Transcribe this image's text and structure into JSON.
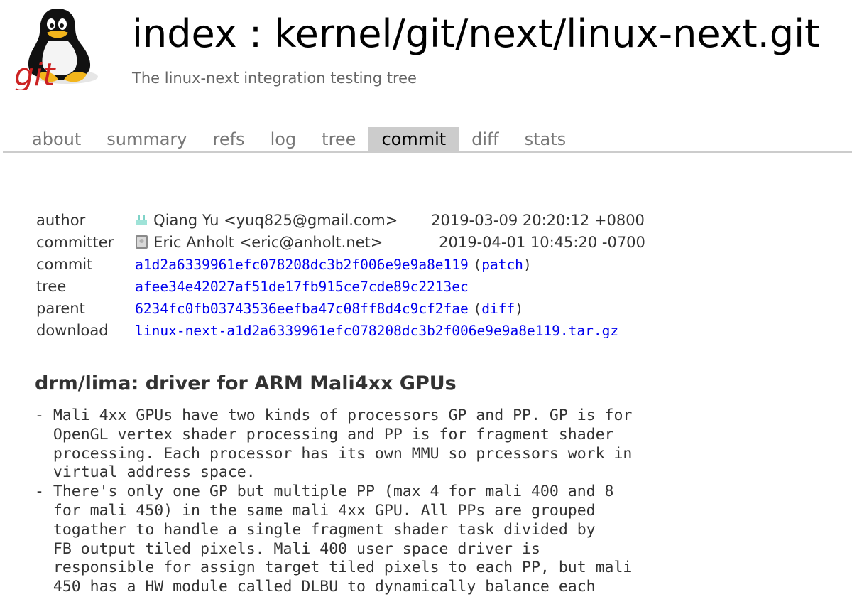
{
  "logo": {
    "text": "git"
  },
  "header": {
    "title": "index : kernel/git/next/linux-next.git",
    "subtitle": "The linux-next integration testing tree"
  },
  "tabs": [
    {
      "label": "about"
    },
    {
      "label": "summary"
    },
    {
      "label": "refs"
    },
    {
      "label": "log"
    },
    {
      "label": "tree"
    },
    {
      "label": "commit",
      "active": true
    },
    {
      "label": "diff"
    },
    {
      "label": "stats"
    }
  ],
  "commit_info": {
    "author": {
      "label": "author",
      "name": "Qiang Yu <yuq825@gmail.com>",
      "date": "2019-03-09 20:20:12 +0800"
    },
    "committer": {
      "label": "committer",
      "name": "Eric Anholt <eric@anholt.net>",
      "date": "2019-04-01 10:45:20 -0700"
    },
    "commit": {
      "label": "commit",
      "sha": "a1d2a6339961efc078208dc3b2f006e9e9a8e119",
      "extra_link": "patch"
    },
    "tree": {
      "label": "tree",
      "sha": "afee34e42027af51de17fb915ce7cde89c2213ec"
    },
    "parent": {
      "label": "parent",
      "sha": "6234fc0fb03743536eefba47c08ff8d4c9cf2fae",
      "extra_link": "diff"
    },
    "download": {
      "label": "download",
      "file": "linux-next-a1d2a6339961efc078208dc3b2f006e9e9a8e119.tar.gz"
    }
  },
  "commit_subject": "drm/lima: driver for ARM Mali4xx GPUs",
  "commit_message": "- Mali 4xx GPUs have two kinds of processors GP and PP. GP is for\n  OpenGL vertex shader processing and PP is for fragment shader\n  processing. Each processor has its own MMU so prcessors work in\n  virtual address space.\n- There's only one GP but multiple PP (max 4 for mali 400 and 8\n  for mali 450) in the same mali 4xx GPU. All PPs are grouped\n  togather to handle a single fragment shader task divided by\n  FB output tiled pixels. Mali 400 user space driver is\n  responsible for assign target tiled pixels to each PP, but mali\n  450 has a HW module called DLBU to dynamically balance each",
  "colors": {
    "link": "#0000ee",
    "tab_active_bg": "#cccccc",
    "logo_red": "#cc2222"
  }
}
